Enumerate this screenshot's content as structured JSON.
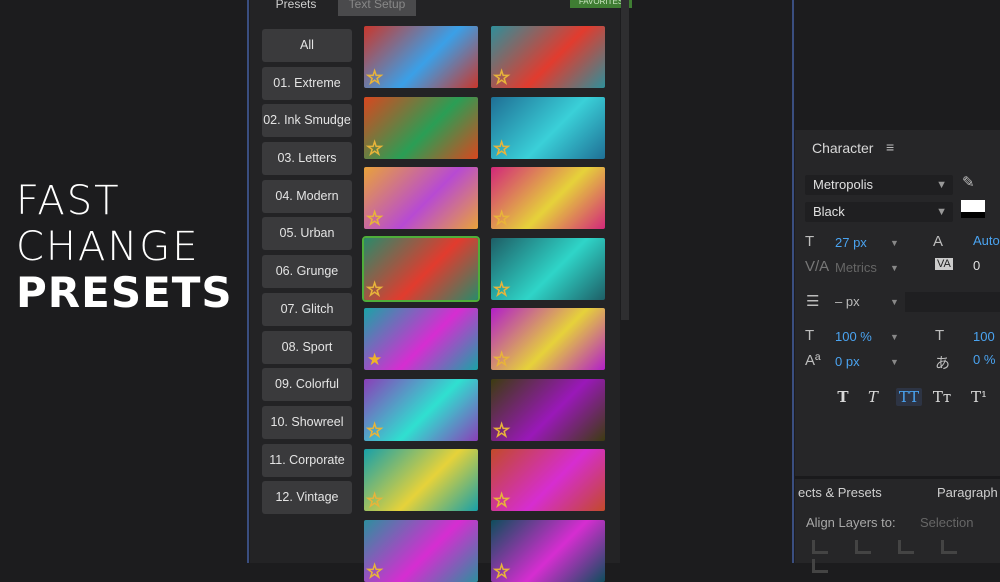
{
  "headline": {
    "line1": "FAST",
    "line2": "CHANGE",
    "line3": "PRESETS"
  },
  "tabs": {
    "presets": "Presets",
    "text_setup": "Text Setup",
    "favorites": "FAVORITES"
  },
  "categories": [
    "All",
    "01. Extreme",
    "02. Ink Smudge",
    "03. Letters",
    "04. Modern",
    "05. Urban",
    "06. Grunge",
    "07. Glitch",
    "08. Sport",
    "09. Colorful",
    "10. Showreel",
    "11. Corporate",
    "12. Vintage"
  ],
  "presets_grid": {
    "rows": 8,
    "columns": 2,
    "selected_index": 6,
    "favorited_index": 8,
    "thumb_colors": [
      "#c9372c",
      "#2f8f9a",
      "#d8471f",
      "#1f6f95",
      "#e9a23a",
      "#d2287a",
      "#2a8a6a",
      "#1e5e66",
      "#1aa3a6",
      "#b21fc9",
      "#8a3fb8",
      "#3c3c10",
      "#18a0a8",
      "#c24a2a",
      "#2d8f9e",
      "#0e4e5c"
    ],
    "thumb_accents": [
      "#3aa0e8",
      "#e23b2e",
      "#2a9e55",
      "#3ad0d8",
      "#b74ad3",
      "#e6d23a",
      "#e23b2e",
      "#2fd5c8",
      "#d62dd1",
      "#e6d23a",
      "#2fe0d0",
      "#9a18b9",
      "#e6d23a",
      "#d62dd1",
      "#d62dd1",
      "#d62dd1"
    ]
  },
  "character": {
    "title": "Character",
    "font_family": "Metropolis",
    "font_style": "Black",
    "font_size": "27 px",
    "leading": "Auto",
    "kerning": "Metrics",
    "tracking": "0",
    "line_spacing": "– px",
    "vertical_scale": "100 %",
    "horizontal_scale": "100",
    "baseline_shift": "0 px",
    "tsume": "0 %"
  },
  "bottom_tabs": {
    "effects": "ects & Presets",
    "paragraph": "Paragraph"
  },
  "align": {
    "label": "Align Layers to:",
    "value": "Selection"
  },
  "colors": {
    "accent_blue": "#4aa3f0",
    "selection_green": "#4fae3a",
    "star": "#e8b43a"
  }
}
